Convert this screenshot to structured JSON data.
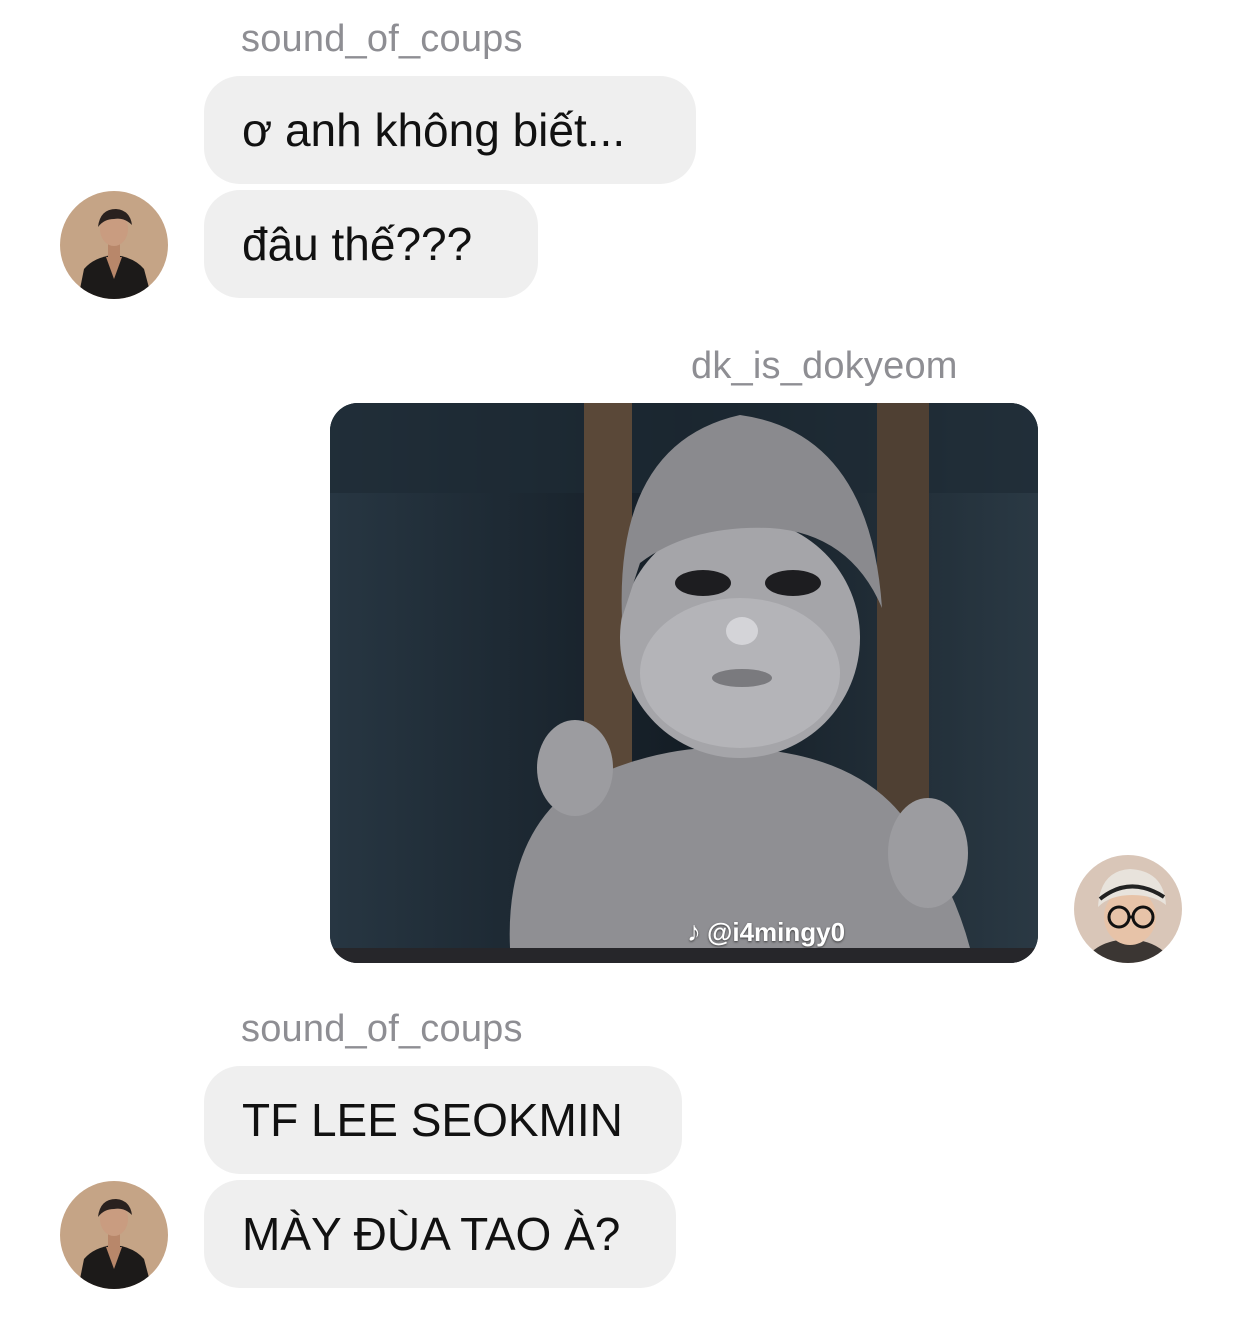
{
  "messages": {
    "group1": {
      "sender": "sound_of_coups",
      "bubbles": [
        "ơ anh không biết...",
        "đâu thế???"
      ],
      "avatar_icon": "profile-avatar-icon"
    },
    "group2": {
      "sender": "dk_is_dokyeom",
      "media": {
        "watermark": "@i4mingy0",
        "watermark_icon": "tiktok-icon"
      },
      "avatar_icon": "profile-avatar-icon"
    },
    "group3": {
      "sender": "sound_of_coups",
      "bubbles": [
        "TF LEE SEOKMIN",
        "MÀY ĐÙA TAO À?"
      ],
      "avatar_icon": "profile-avatar-icon"
    }
  },
  "colors": {
    "bubble_bg": "#efefef",
    "sender_text": "#8e8e93",
    "message_text": "#111111",
    "background": "#ffffff"
  }
}
